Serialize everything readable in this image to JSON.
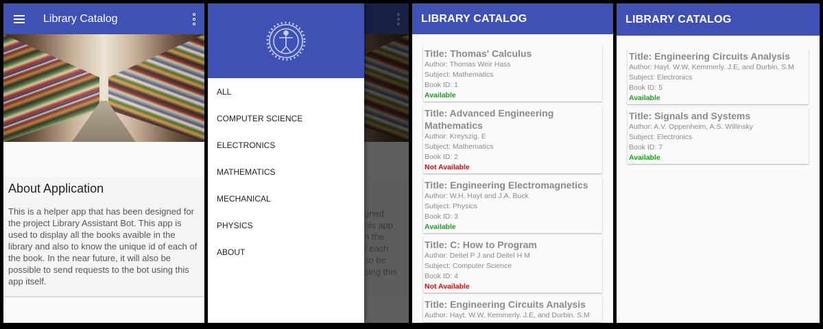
{
  "screen_home": {
    "app_title": "Library Catalog",
    "about_title": "About Application",
    "about_text": "This is a helper app that has been designed for the project Library Assistant Bot. This app is used to display all the books avaible in the library and also to know the unique id of each of the book. In the near future, it will also be possible to send requests to the bot using this app itself."
  },
  "drawer": {
    "items": [
      "ALL",
      "COMPUTER SCIENCE",
      "ELECTRONICS",
      "MATHEMATICS",
      "MECHANICAL",
      "PHYSICS",
      "ABOUT"
    ],
    "dimmed_text_fragment": "gned\nhis app\nn the\nf each\nso be\nsing this"
  },
  "list_all": {
    "app_title": "LIBRARY CATALOG",
    "books": [
      {
        "title": "Title: Thomas' Calculus",
        "author": "Author: Thomas Weir Hass",
        "subject": "Subject: Mathematics",
        "book_id": "Book ID: 1",
        "status": "Available"
      },
      {
        "title": "Title: Advanced Engineering Mathematics",
        "author": "Author: Kreyszig. E",
        "subject": "Subject: Mathematics",
        "book_id": "Book ID: 2",
        "status": "Not Available"
      },
      {
        "title": "Title: Engineering Electromagnetics",
        "author": "Author: W.H. Hayt and J.A. Buck",
        "subject": "Subject: Physics",
        "book_id": "Book ID: 3",
        "status": "Available"
      },
      {
        "title": "Title: C: How to Program",
        "author": "Author: Deitel P J and Deitel H M",
        "subject": "Subject: Computer Science",
        "book_id": "Book ID: 4",
        "status": "Not Available"
      },
      {
        "title": "Title: Engineering Circuits Analysis",
        "author": "Author: Hayt. W.W, Kemmerly. J.E, and Durbin. S.M",
        "subject": "",
        "book_id": "",
        "status": ""
      }
    ]
  },
  "list_electronics": {
    "app_title": "LIBRARY CATALOG",
    "books": [
      {
        "title": "Title: Engineering Circuits Analysis",
        "author": "Author: Hayt. W.W, Kemmerly. J.E, and Durbin. S.M",
        "subject": "Subject: Electronics",
        "book_id": "Book ID: 5",
        "status": "Available"
      },
      {
        "title": "Title: Signals and Systems",
        "author": "Author: A.V. Oppenheim, A.S. Willinsky",
        "subject": "Subject: Electronics",
        "book_id": "Book ID: 7",
        "status": "Available"
      }
    ]
  },
  "colors": {
    "primary": "#3f51b5",
    "available": "#19a319",
    "not_available": "#cc1111"
  }
}
